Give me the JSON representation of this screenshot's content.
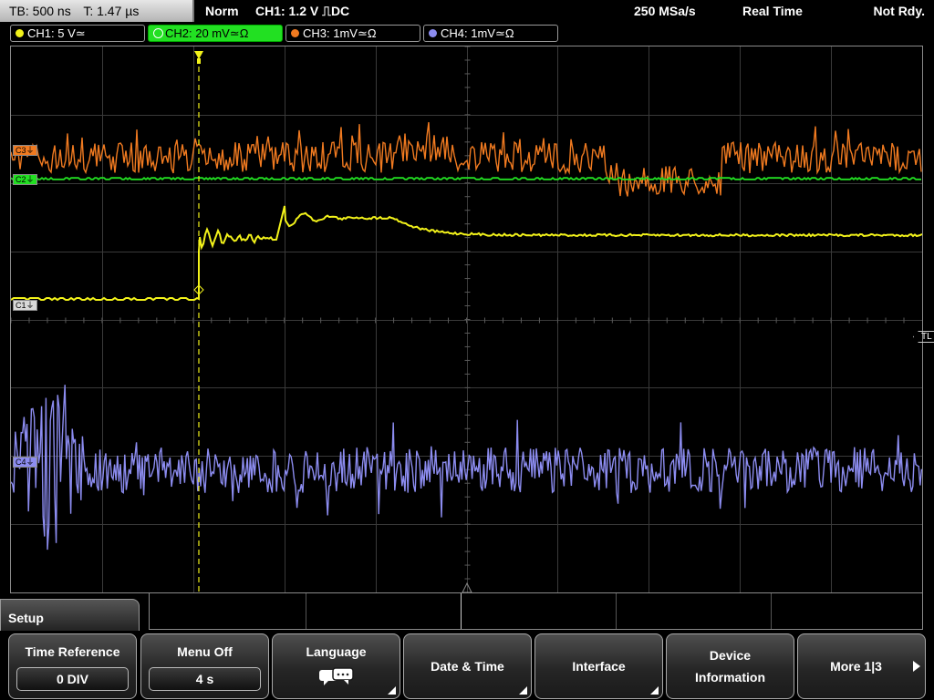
{
  "timebase": {
    "tb": "TB: 500 ns",
    "trigger_time": "T: 1.47 µs"
  },
  "status": {
    "mode": "Norm",
    "trigger": "CH1: 1.2 V ⎍DC",
    "sample_rate": "250 MSa/s",
    "acq_mode": "Real Time",
    "state": "Not Rdy."
  },
  "channels": [
    {
      "label": "CH1: 5 V≃",
      "color": "#f2f21a"
    },
    {
      "label": "CH2: 20 mV≃Ω",
      "color": "#22e022"
    },
    {
      "label": "CH3: 1mV≃Ω",
      "color": "#f07a20"
    },
    {
      "label": "CH4: 1mV≃Ω",
      "color": "#8c8cf0"
    }
  ],
  "markers": {
    "ch1_ref": "C1⏚",
    "ch2_ref": "C2⏚",
    "ch3_ref": "C3⏚",
    "ch4_ref": "C4⏚",
    "trigger_level": "TL"
  },
  "menu": {
    "title": "Setup",
    "time_reference": {
      "label": "Time Reference",
      "value": "0 DIV"
    },
    "menu_off": {
      "label": "Menu Off",
      "value": "4 s"
    },
    "language": {
      "label": "Language",
      "icon": "speech-bubbles-icon"
    },
    "date_time": "Date & Time",
    "interface": "Interface",
    "device_information": "Device Information",
    "more": "More 1|3"
  }
}
